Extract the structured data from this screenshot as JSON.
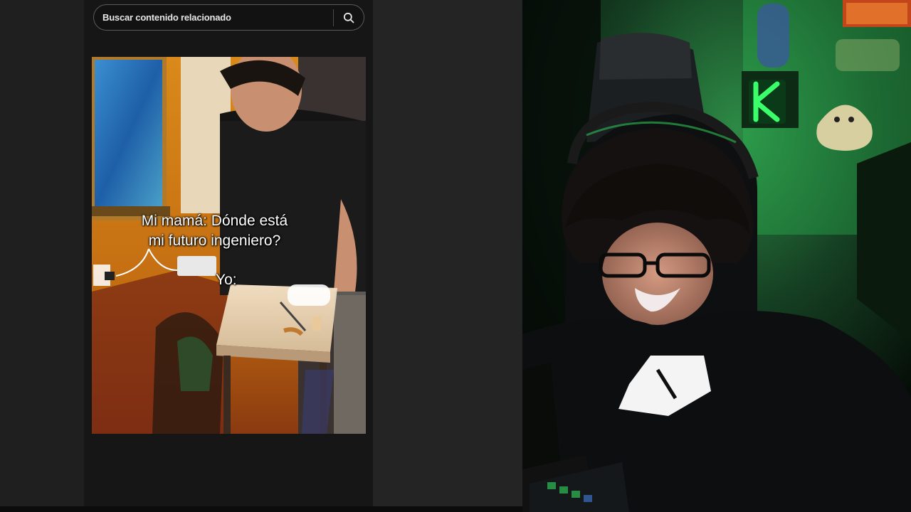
{
  "search": {
    "placeholder": "Buscar contenido relacionado"
  },
  "video": {
    "caption_line_1": "Mi mamá: Dónde está",
    "caption_line_2": "mi futuro ingeniero?",
    "caption_reply": "Yo:"
  },
  "icons": {
    "search": "search-icon",
    "logo_sign": "neon-k-logo"
  },
  "colors": {
    "app_background": "#161616",
    "neon_green": "#3bff6a",
    "caption_text": "#ffffff"
  }
}
